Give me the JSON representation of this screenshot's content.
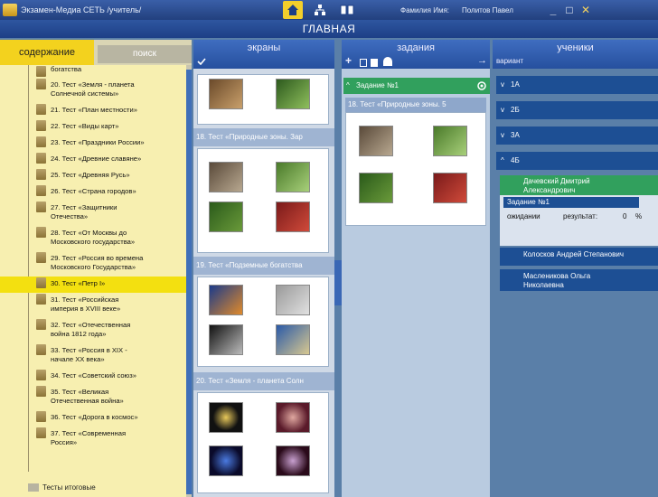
{
  "titlebar": {
    "title": "Экзамен-Медиа СЕТЬ /учитель/",
    "user_label": "Фамилия Имя:",
    "user_name": "Политов Павел",
    "minimize": "_",
    "maximize": "□",
    "close": "✕"
  },
  "header": {
    "title": "ГЛАВНАЯ"
  },
  "left_panel": {
    "tab_contents": "содержание",
    "tab_search": "поиск",
    "items": [
      {
        "label": "богатства"
      },
      {
        "label": "20. Тест «Земля - планета\nСолнечной системы»"
      },
      {
        "label": "21. Тест «План местности»"
      },
      {
        "label": "22. Тест «Виды карт»"
      },
      {
        "label": "23. Тест «Праздники России»"
      },
      {
        "label": "24. Тест «Древние славяне»"
      },
      {
        "label": "25. Тест «Древняя Русь»"
      },
      {
        "label": "26. Тест «Страна городов»"
      },
      {
        "label": "27. Тест «Защитники\nОтечества»"
      },
      {
        "label": "28. Тест «От Москвы до\nМосковского государства»"
      },
      {
        "label": "29. Тест «Россия во времена\nМосковского Государства»"
      },
      {
        "label": "30. Тест «Петр I»"
      },
      {
        "label": "31. Тест «Российская\nимперия в XVIII веке»"
      },
      {
        "label": "32. Тест «Отечественная\nвойна 1812 года»"
      },
      {
        "label": "33. Тест «Россия в XIX -\nначале XX века»"
      },
      {
        "label": "34. Тест «Советский союз»"
      },
      {
        "label": "35. Тест «Великая\nОтечественная война»"
      },
      {
        "label": "36. Тест «Дорога в космос»"
      },
      {
        "label": "37. Тест «Современная\nРоссия»"
      }
    ],
    "selected_index": 11,
    "final_tests": "Тесты итоговые"
  },
  "screens": {
    "title": "экраны",
    "bars": [
      "18. Тест «Природные зоны. Зар",
      "19. Тест «Подземные богатства",
      "20. Тест «Земля - планета Солн"
    ]
  },
  "tasks": {
    "title": "задания",
    "task_header": "Задание №1",
    "card_title": "18. Тест «Природные зоны. 5"
  },
  "students": {
    "title": "ученики",
    "variant_label": "вариант",
    "groups": [
      "1А",
      "2Б",
      "3А",
      "4Б"
    ],
    "expanded_student": "Дачевский Дмитрий\nАлександрович",
    "task_row": "Задание №1",
    "status_waiting": "ожидании",
    "result_label": "результат:",
    "result_value": "0",
    "result_unit": "%",
    "others": [
      "Колосков Андрей Степанович",
      "Масленикова Ольга\nНиколаевна"
    ]
  },
  "colors": {
    "accent": "#f3cf2b",
    "panel_blue": "#1d4f94",
    "green": "#31a05d"
  },
  "icons": [
    "home-icon",
    "network-icon",
    "book-icon",
    "doc-icon",
    "check-icon",
    "plus-icon",
    "gear-icon"
  ]
}
